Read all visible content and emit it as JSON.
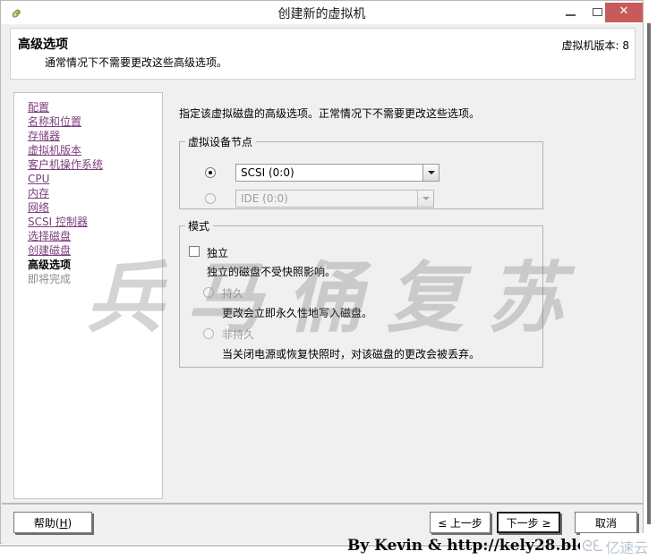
{
  "window": {
    "title": "创建新的虚拟机",
    "icon": "vm-link-icon",
    "minimize_label": "—",
    "maximize_label": "□",
    "close_label": "✕",
    "close_color": "#c75b5b"
  },
  "header": {
    "title": "高级选项",
    "subtitle": "通常情况下不需要更改这些高级选项。",
    "version": "虚拟机版本: 8"
  },
  "sidebar": {
    "items": [
      {
        "label": "配置",
        "state": "link"
      },
      {
        "label": "名称和位置",
        "state": "link"
      },
      {
        "label": "存储器",
        "state": "link"
      },
      {
        "label": "虚拟机版本",
        "state": "link"
      },
      {
        "label": "客户机操作系统",
        "state": "link"
      },
      {
        "label": "CPU",
        "state": "link"
      },
      {
        "label": "内存",
        "state": "link"
      },
      {
        "label": "网络",
        "state": "link"
      },
      {
        "label": "SCSI 控制器",
        "state": "link"
      },
      {
        "label": "选择磁盘",
        "state": "link"
      },
      {
        "label": "创建磁盘",
        "state": "link"
      },
      {
        "label": "高级选项",
        "state": "current"
      },
      {
        "label": "即将完成",
        "state": "pending"
      }
    ]
  },
  "main": {
    "description": "指定该虚拟磁盘的高级选项。正常情况下不需要更改这些选项。",
    "device_node_group": {
      "legend": "虚拟设备节点",
      "options": [
        {
          "value": "SCSI (0:0)",
          "selected": true,
          "disabled": false
        },
        {
          "value": "IDE (0:0)",
          "selected": false,
          "disabled": true
        }
      ]
    },
    "mode_group": {
      "legend": "模式",
      "independent": {
        "label": "独立",
        "checked": false,
        "description": "独立的磁盘不受快照影响。"
      },
      "options": [
        {
          "label": "持久",
          "selected": false,
          "disabled": true,
          "description": "更改会立即永久性地写入磁盘。"
        },
        {
          "label": "非持久",
          "selected": false,
          "disabled": true,
          "description": "当关闭电源或恢复快照时，对该磁盘的更改会被丢弃。"
        }
      ]
    }
  },
  "footer": {
    "help": "帮助(H)",
    "help_prefix": "帮助(",
    "help_key": "H",
    "help_suffix": ")",
    "back": "≤ 上一步",
    "next": "下一步 ≥",
    "cancel": "取消"
  },
  "overlays": {
    "watermark": "兵马俑复苏",
    "credit": "By Kevin & http://kely28.blo",
    "logo_text": "亿速云",
    "logo_mark": "ᘓᘍ"
  }
}
